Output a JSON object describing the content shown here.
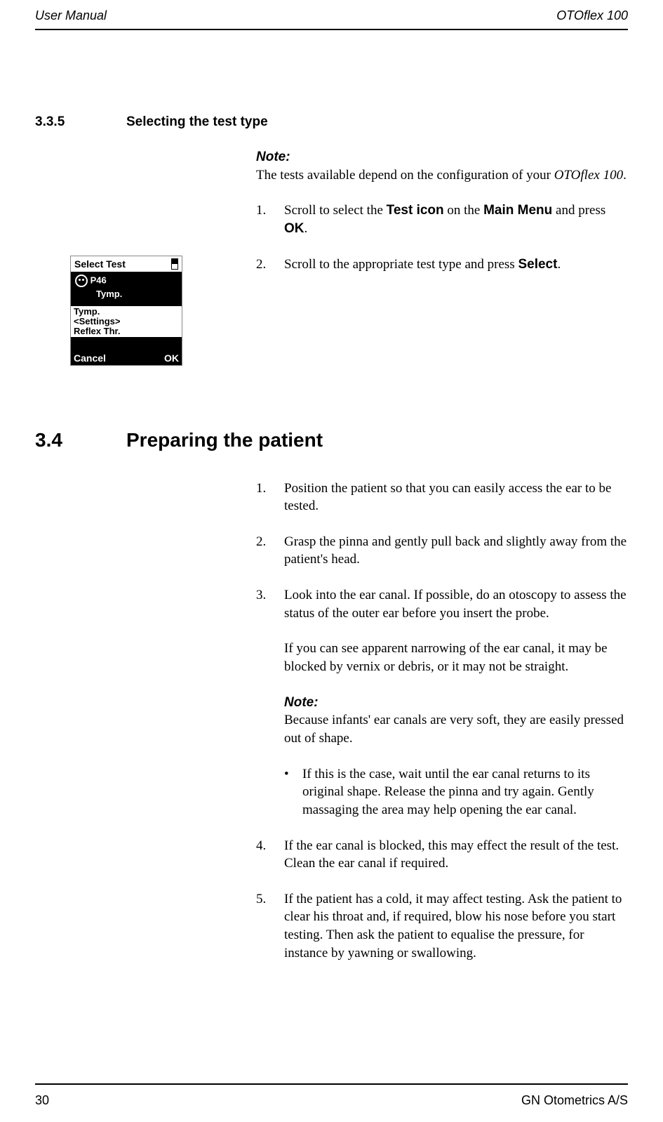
{
  "header": {
    "left": "User Manual",
    "right": "OTOflex 100"
  },
  "section335": {
    "number": "3.3.5",
    "title": "Selecting the test type",
    "note_label": "Note:",
    "note_text_1": "The tests available depend on the configuration of your ",
    "note_text_2": "OTOflex 100",
    "note_text_3": ".",
    "step1": {
      "num": "1.",
      "text_1": "Scroll to select the ",
      "text_2": "Test icon",
      "text_3": " on the ",
      "text_4": "Main Menu",
      "text_5": " and press ",
      "text_6": "OK",
      "text_7": "."
    },
    "step2": {
      "num": "2.",
      "text_1": "Scroll to the appropriate test type and press ",
      "text_2": "Select",
      "text_3": "."
    }
  },
  "device_screen": {
    "title": "Select Test",
    "line1": "P46",
    "line2": "Tymp.",
    "menu1": "Tymp.",
    "menu2": "<Settings>",
    "menu3": "Reflex Thr.",
    "softkey_left": "Cancel",
    "softkey_right": "OK"
  },
  "section34": {
    "number": "3.4",
    "title": "Preparing the patient",
    "step1": {
      "num": "1.",
      "text": "Position the patient so that you can easily access the ear to be tested."
    },
    "step2": {
      "num": "2.",
      "text": "Grasp the pinna and gently pull back and slightly away from the patient's head."
    },
    "step3": {
      "num": "3.",
      "text": "Look into the ear canal. If possible, do an otoscopy to assess the status of the outer ear before you insert the probe.",
      "text_sub": "If you can see apparent narrowing of the ear canal, it may be blocked by vernix or debris, or it may not be straight."
    },
    "note_label": "Note:",
    "note_text": "Because infants' ear canals are very soft, they are easily pressed out of shape.",
    "bullet": {
      "marker": "•",
      "text": "If this is the case, wait until the ear canal returns to its original shape. Release the pinna and try again. Gently massaging the area may help opening the ear canal."
    },
    "step4": {
      "num": "4.",
      "text": "If the ear canal is blocked, this may effect the result of the test. Clean the ear canal if required."
    },
    "step5": {
      "num": "5.",
      "text": "If the patient has a cold, it may affect testing. Ask the patient to clear his throat and, if required, blow his nose before you start testing. Then ask the patient to equalise the pressure, for instance by yawning or swallowing."
    }
  },
  "footer": {
    "page": "30",
    "company": "GN Otometrics A/S"
  }
}
